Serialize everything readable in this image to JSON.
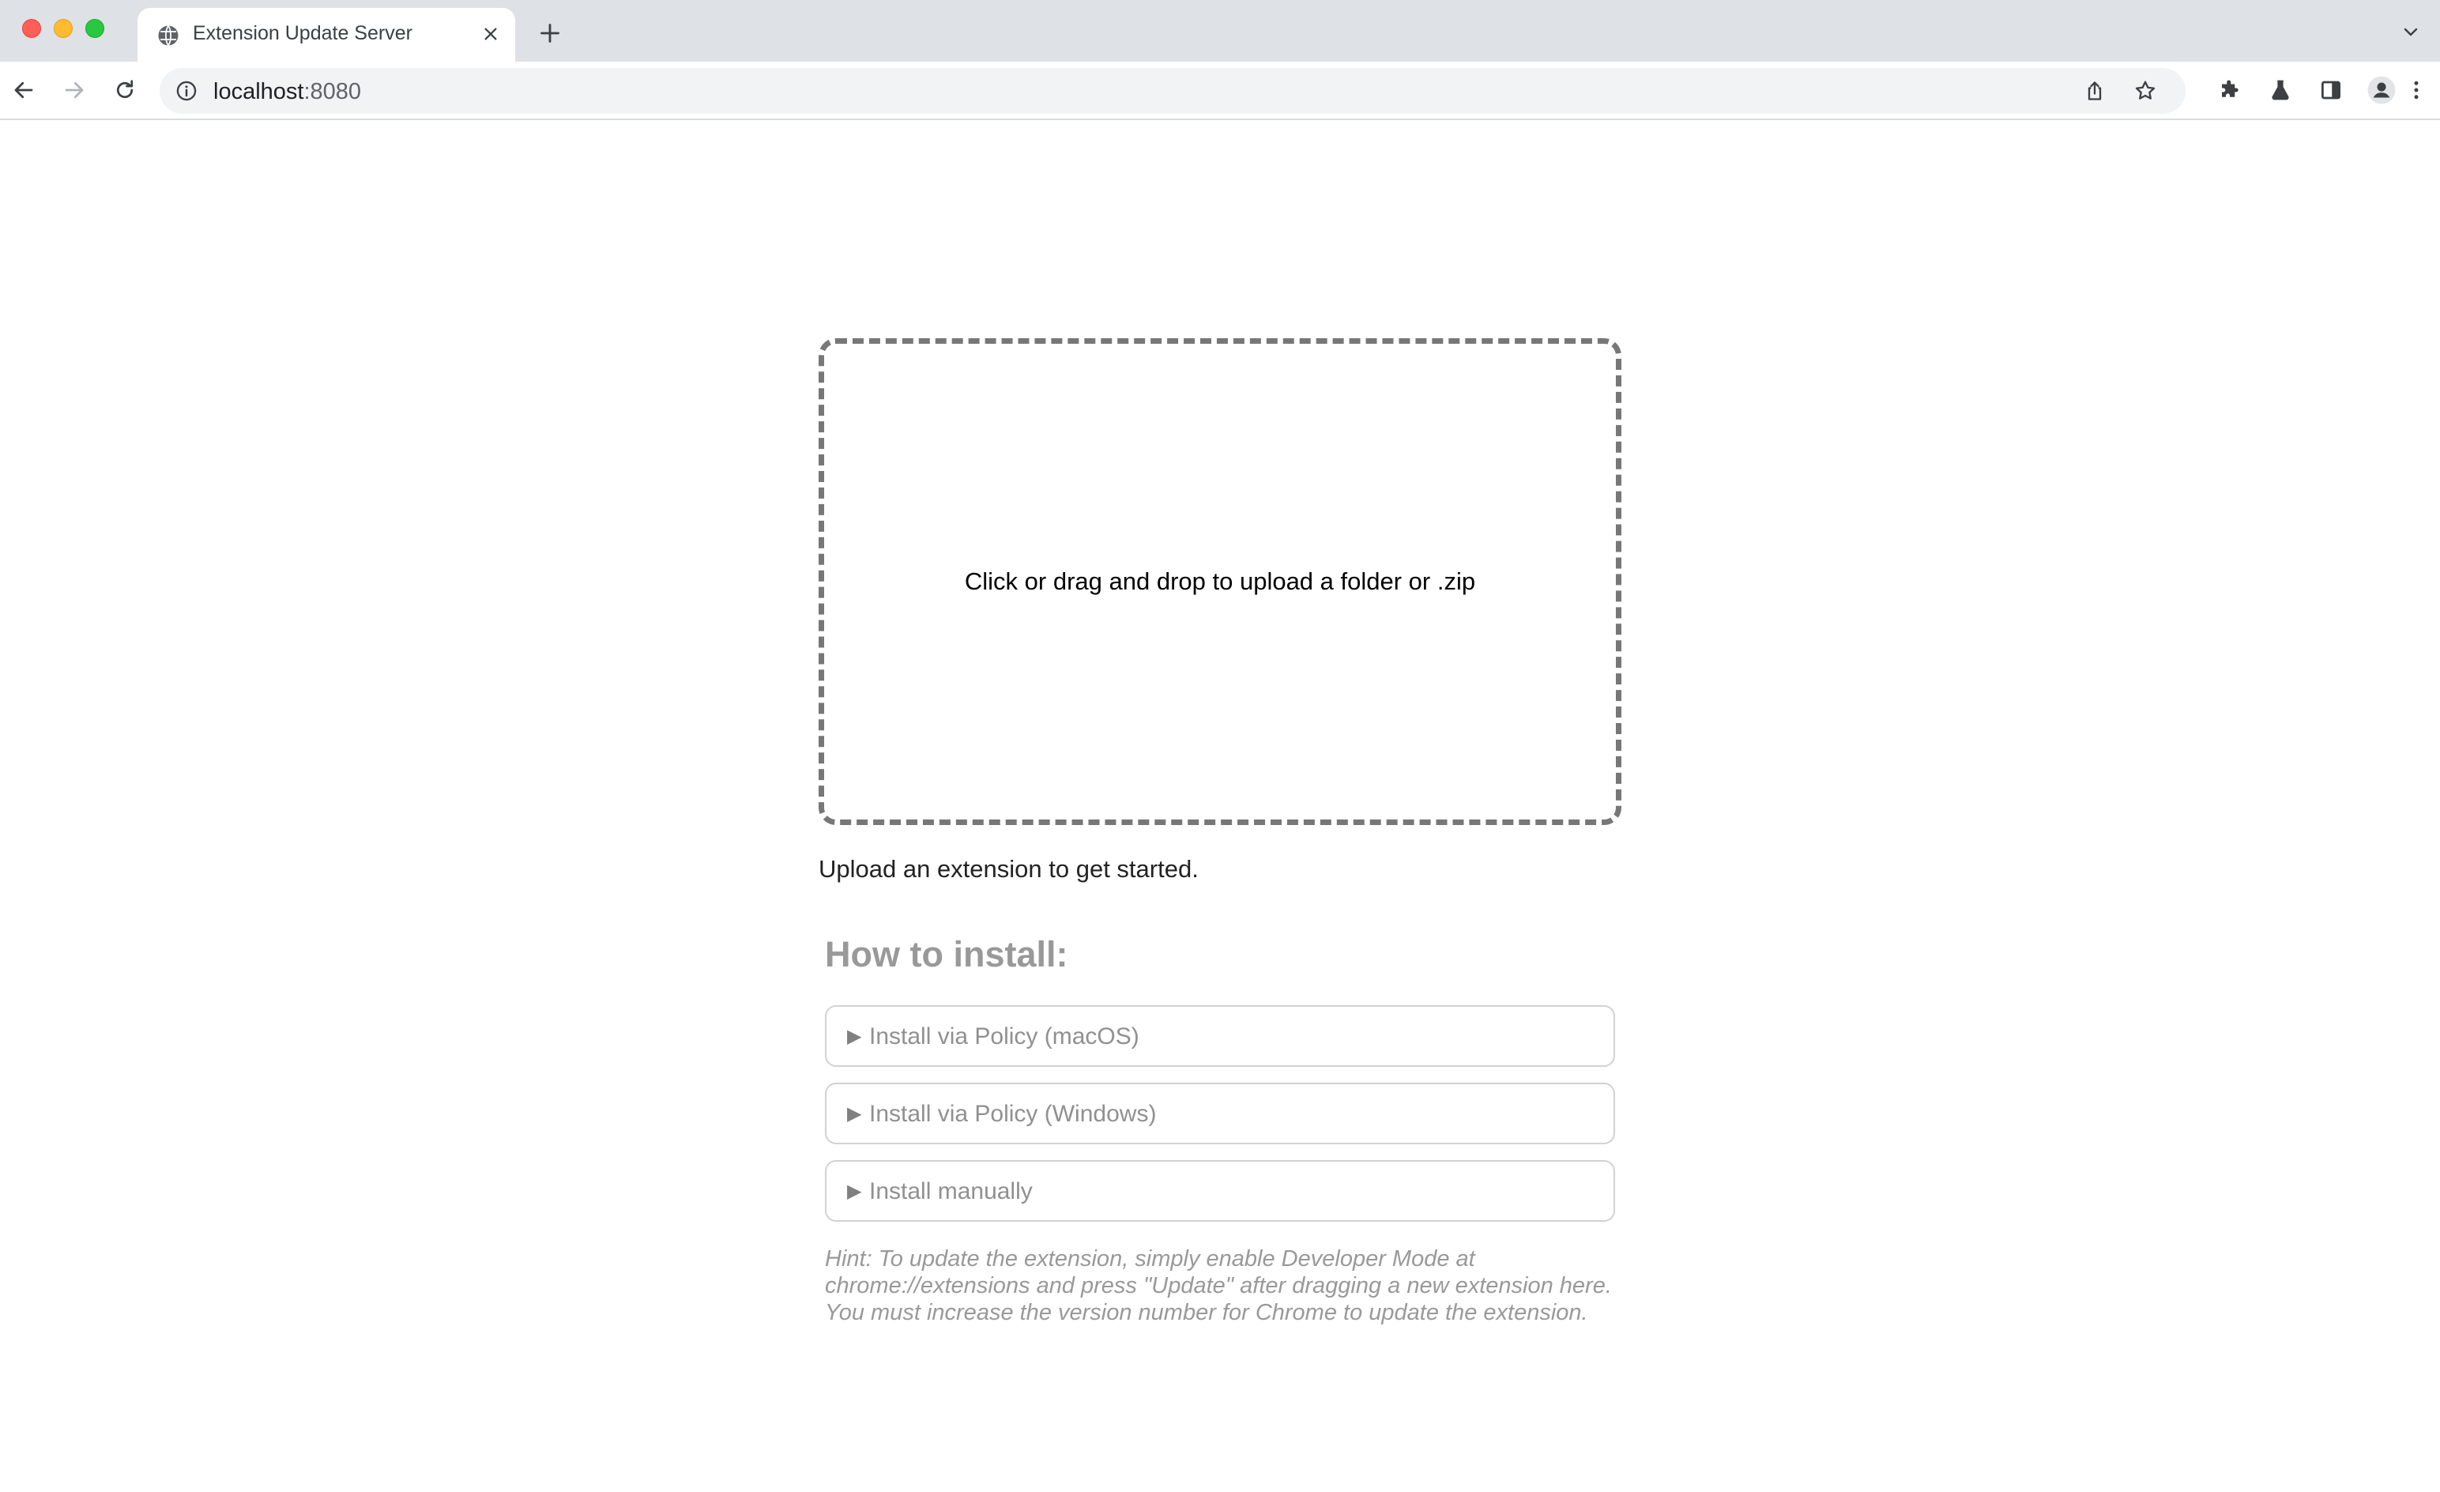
{
  "browser": {
    "tab_title": "Extension Update Server",
    "url_host": "localhost",
    "url_port": ":8080",
    "icons": [
      "globe-icon",
      "close-icon",
      "plus-icon",
      "chevron-down-icon",
      "back-arrow-icon",
      "forward-arrow-icon",
      "reload-icon",
      "info-icon",
      "share-icon",
      "star-icon",
      "puzzle-icon",
      "flask-icon",
      "side-panel-icon",
      "profile-icon",
      "more-vert-icon"
    ]
  },
  "upload": {
    "dropzone_label": "Click or drag and drop to upload a folder or .zip",
    "status": "Upload an extension to get started."
  },
  "install": {
    "title": "How to install:",
    "arrow": "▶",
    "sections": [
      {
        "label": "Install via Policy (macOS)"
      },
      {
        "label": "Install via Policy (Windows)"
      },
      {
        "label": "Install manually"
      }
    ],
    "hint": "Hint: To update the extension, simply enable Developer Mode at chrome://extensions and press \"Update\" after dragging a new extension here. You must increase the version number for Chrome to update the extension."
  },
  "colors": {
    "tabstrip_bg": "#dee1e6",
    "dropzone_border": "#777777",
    "muted_text": "#999999"
  }
}
